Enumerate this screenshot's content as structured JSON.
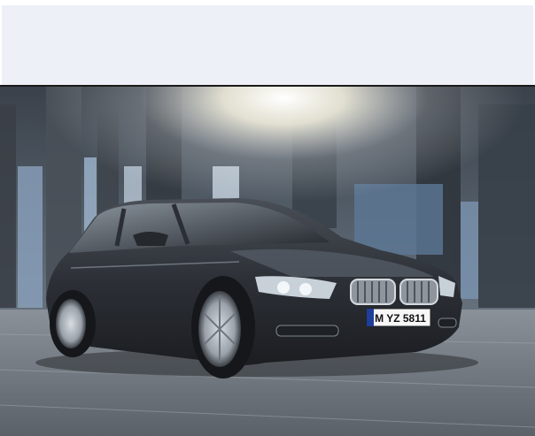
{
  "hero": {
    "license_plate": "M YZ 5811",
    "colors": {
      "banner_bg": "#eef0f7",
      "car_body": "#2b2f35",
      "sky_glow": "#fffdf0",
      "floor": "#6d737c"
    }
  }
}
